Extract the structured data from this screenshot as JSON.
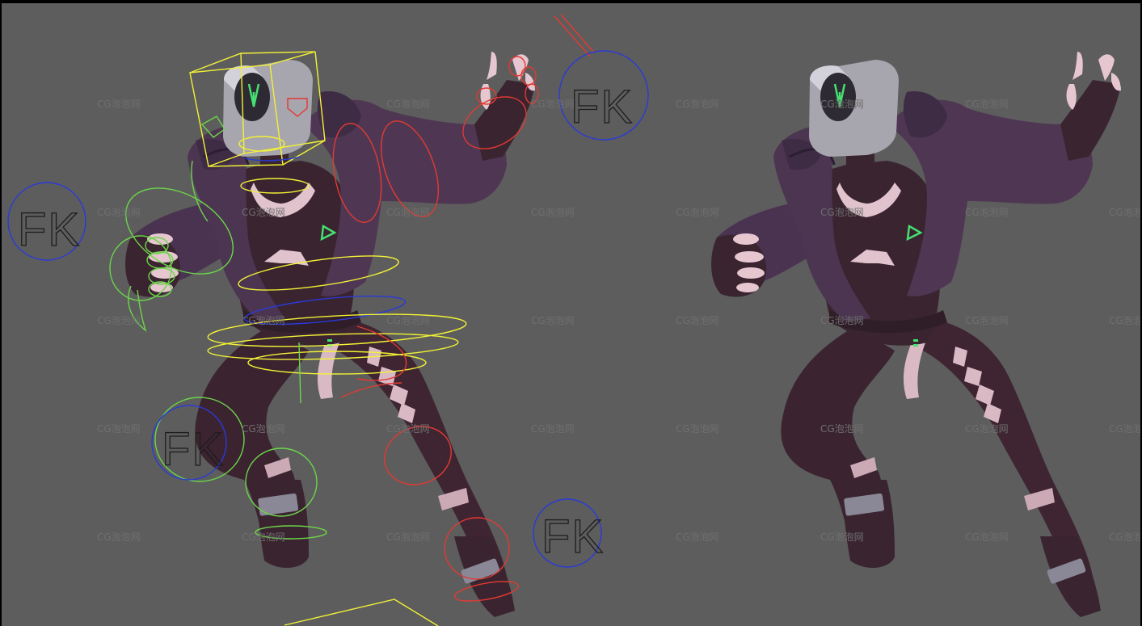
{
  "viewport": {
    "background": "#5d5d5d",
    "frame": "#000000"
  },
  "watermark": {
    "text": "CG泡泡网",
    "color": "#6f6f6f"
  },
  "fk_labels": [
    "FK",
    "FK",
    "FK",
    "FK"
  ],
  "colors": {
    "body_dark": "#3a2430",
    "jacket": "#4c3550",
    "jacket_dark": "#3a2840",
    "skin_light": "#e6c6cf",
    "head_box": "#a7a5ad",
    "accent_green": "#45e070",
    "ctrl_yellow": "#f2f236",
    "ctrl_red": "#e23a32",
    "ctrl_green": "#6cd64a",
    "ctrl_blue": "#2a3ad6"
  },
  "models": [
    {
      "id": "rigged",
      "controls_visible": true
    },
    {
      "id": "clean",
      "controls_visible": false
    }
  ]
}
